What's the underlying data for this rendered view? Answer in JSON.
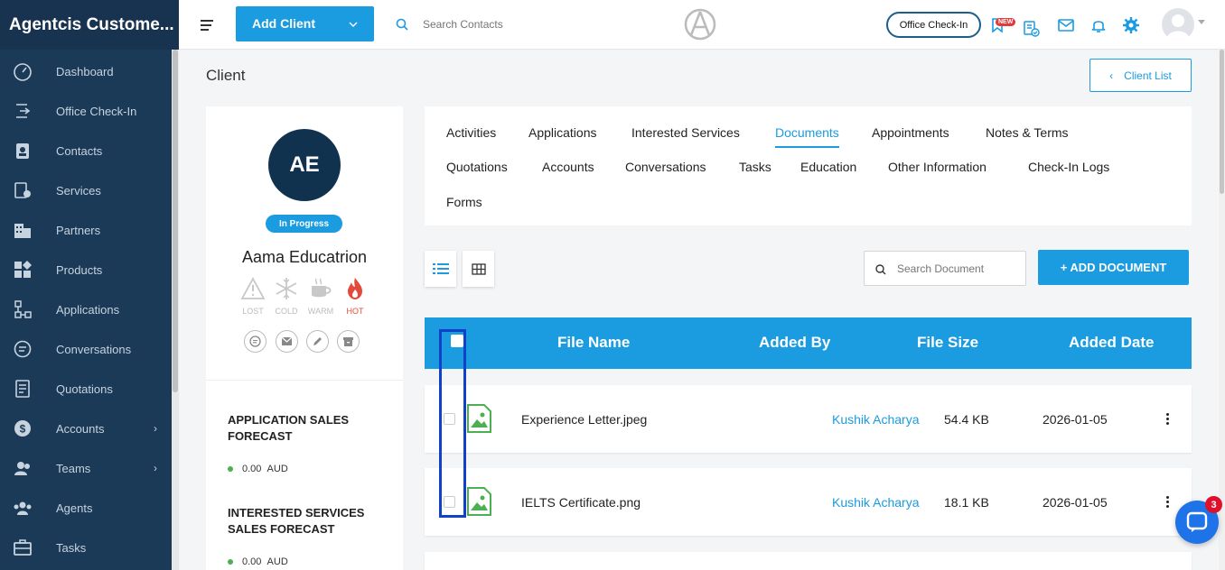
{
  "app": {
    "brand": "Agentcis Custome..."
  },
  "sidebar": {
    "items": [
      {
        "label": "Dashboard",
        "icon": "dashboard-icon"
      },
      {
        "label": "Office Check-In",
        "icon": "check-in-icon"
      },
      {
        "label": "Contacts",
        "icon": "contacts-icon"
      },
      {
        "label": "Services",
        "icon": "services-icon"
      },
      {
        "label": "Partners",
        "icon": "partners-icon"
      },
      {
        "label": "Products",
        "icon": "products-icon"
      },
      {
        "label": "Applications",
        "icon": "applications-icon"
      },
      {
        "label": "Conversations",
        "icon": "conversations-icon"
      },
      {
        "label": "Quotations",
        "icon": "quotations-icon"
      },
      {
        "label": "Accounts",
        "icon": "accounts-icon",
        "has_submenu": true
      },
      {
        "label": "Teams",
        "icon": "teams-icon",
        "has_submenu": true
      },
      {
        "label": "Agents",
        "icon": "agents-icon"
      },
      {
        "label": "Tasks",
        "icon": "tasks-icon"
      }
    ]
  },
  "topbar": {
    "add_client_label": "Add Client",
    "search_placeholder": "Search Contacts",
    "checkin_label": "Office Check-In",
    "new_badge": "NEW"
  },
  "page": {
    "title": "Client",
    "client_list_label": "Client List"
  },
  "profile": {
    "initials": "AE",
    "status": "In Progress",
    "name": "Aama Educatrion",
    "temperatures": [
      "LOST",
      "COLD",
      "WARM",
      "HOT"
    ],
    "forecasts": [
      {
        "title": "APPLICATION SALES FORECAST",
        "value": "0.00",
        "currency": "AUD"
      },
      {
        "title": "INTERESTED SERVICES SALES FORECAST",
        "value": "0.00",
        "currency": "AUD"
      }
    ]
  },
  "tabs": [
    "Activities",
    "Applications",
    "Interested Services",
    "Documents",
    "Appointments",
    "Notes & Terms",
    "Quotations",
    "Accounts",
    "Conversations",
    "Tasks",
    "Education",
    "Other Information",
    "Check-In Logs",
    "Forms"
  ],
  "active_tab": "Documents",
  "documents": {
    "search_placeholder": "Search Document",
    "add_label": "+ ADD DOCUMENT",
    "columns": [
      "File Name",
      "Added By",
      "File Size",
      "Added Date"
    ],
    "rows": [
      {
        "file_name": "Experience Letter.jpeg",
        "added_by": "Kushik Acharya",
        "size": "54.4 KB",
        "date": "2026-01-05"
      },
      {
        "file_name": "IELTS Certificate.png",
        "added_by": "Kushik Acharya",
        "size": "18.1 KB",
        "date": "2026-01-05"
      }
    ]
  },
  "chat": {
    "unread": "3"
  },
  "colors": {
    "accent": "#1b9be0",
    "sidebar": "#1b3a57",
    "highlight": "#1141c8"
  }
}
